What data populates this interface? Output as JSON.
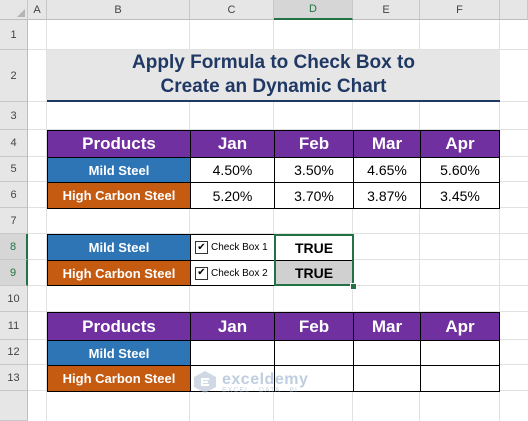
{
  "columns": [
    "A",
    "B",
    "C",
    "D",
    "E",
    "F"
  ],
  "rows": [
    "1",
    "2",
    "3",
    "4",
    "5",
    "6",
    "7",
    "8",
    "9",
    "10",
    "11",
    "12",
    "13"
  ],
  "title": {
    "line1": "Apply Formula to Check Box to",
    "line2": "Create an Dynamic Chart"
  },
  "table1": {
    "header": [
      "Products",
      "Jan",
      "Feb",
      "Mar",
      "Apr"
    ],
    "rows": [
      {
        "product": "Mild Steel",
        "values": [
          "4.50%",
          "3.50%",
          "4.65%",
          "5.60%"
        ]
      },
      {
        "product": "High Carbon Steel",
        "values": [
          "5.20%",
          "3.70%",
          "3.87%",
          "3.45%"
        ]
      }
    ]
  },
  "checks": [
    {
      "product": "Mild Steel",
      "checkbox_label": "Check Box 1",
      "checked": true,
      "value": "TRUE"
    },
    {
      "product": "High Carbon Steel",
      "checkbox_label": "Check Box 2",
      "checked": true,
      "value": "TRUE"
    }
  ],
  "table2": {
    "header": [
      "Products",
      "Jan",
      "Feb",
      "Mar",
      "Apr"
    ],
    "rows": [
      "Mild Steel",
      "High Carbon Steel"
    ]
  },
  "watermark": {
    "name": "exceldemy",
    "tagline": "EXCEL · DATA · BI"
  },
  "colors": {
    "purple": "#7030a0",
    "blue": "#2e75b6",
    "orange": "#c55a11",
    "title_text": "#1f3864",
    "selection": "#217346"
  },
  "selected_column": "D",
  "selected_rows": [
    "8",
    "9"
  ]
}
